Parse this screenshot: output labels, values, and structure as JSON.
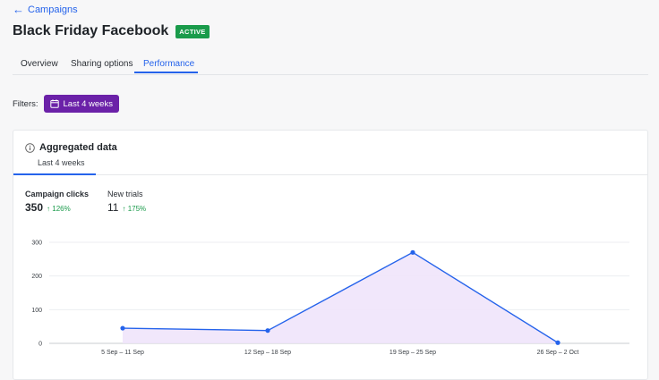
{
  "nav": {
    "back_label": "Campaigns"
  },
  "campaign": {
    "title": "Black Friday Facebook",
    "status": "ACTIVE"
  },
  "tabs": [
    {
      "label": "Overview"
    },
    {
      "label": "Sharing options"
    },
    {
      "label": "Performance",
      "active": true
    }
  ],
  "filters": {
    "label": "Filters:",
    "date_range": "Last 4 weeks"
  },
  "card": {
    "title": "Aggregated data",
    "tab_label": "Last 4 weeks"
  },
  "metrics": [
    {
      "label": "Campaign clicks",
      "value": "350",
      "change": "126%"
    },
    {
      "label": "New trials",
      "value": "11",
      "change": "175%"
    }
  ],
  "colors": {
    "accent": "#2563eb",
    "filter": "#6b21a8",
    "positive": "#1a9b4b",
    "area": "#efe4fb"
  },
  "chart_data": {
    "type": "area",
    "categories": [
      "5 Sep – 11 Sep",
      "12 Sep – 18 Sep",
      "19 Sep – 25 Sep",
      "26 Sep – 2 Oct"
    ],
    "values": [
      45,
      38,
      270,
      2
    ],
    "ylim": [
      0,
      300
    ],
    "yticks": [
      0,
      100,
      200,
      300
    ],
    "grid": true
  }
}
